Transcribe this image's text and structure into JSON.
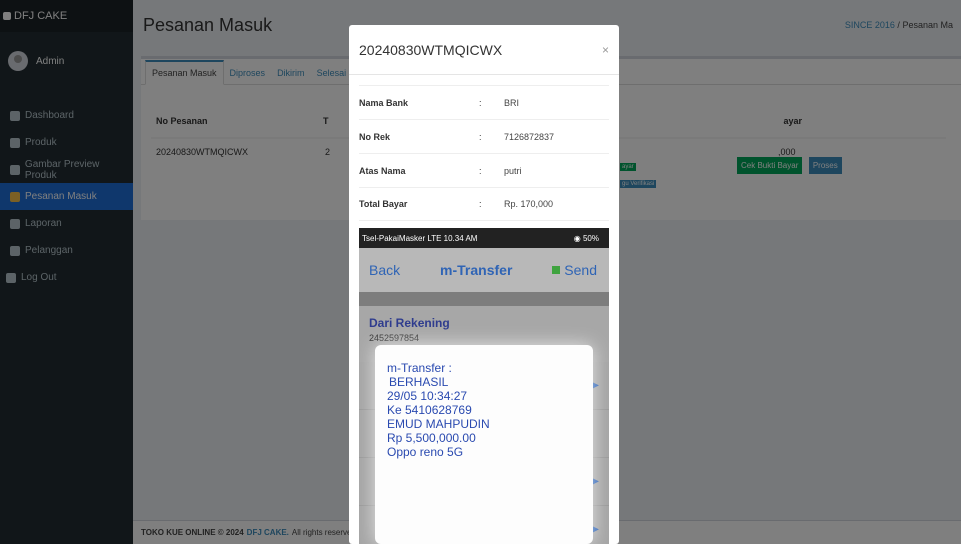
{
  "sidebar": {
    "brand": "DFJ CAKE",
    "user": "Admin",
    "items": [
      {
        "label": "Dashboard",
        "icon": "dashboard-icon"
      },
      {
        "label": "Produk",
        "icon": "building-icon"
      },
      {
        "label": "Gambar Preview Produk",
        "icon": "image-icon"
      },
      {
        "label": "Pesanan Masuk",
        "icon": "download-icon",
        "active": true
      },
      {
        "label": "Laporan",
        "icon": "file-icon"
      },
      {
        "label": "Pelanggan",
        "icon": "users-icon"
      },
      {
        "label": "Log Out",
        "icon": "logout-icon"
      }
    ]
  },
  "header": {
    "title": "Pesanan Masuk",
    "breadcrumb_link": "SINCE 2016",
    "breadcrumb_sep": "/",
    "breadcrumb_current": "Pesanan Ma"
  },
  "tabs": [
    "Pesanan Masuk",
    "Diproses",
    "Dikirim",
    "Selesai"
  ],
  "table": {
    "col_no_pesanan": "No Pesanan",
    "col_total_partial": "T",
    "col_bayar_partial": "ayar",
    "row_no": "20240830WTMQICWX",
    "row_total_partial": "2",
    "row_bayar_partial": ",000",
    "badge1_partial": "ayar",
    "badge2_partial": "gu Verifikasi",
    "btn_cek": "Cek Bukti Bayar",
    "btn_proses": "Proses"
  },
  "footer": {
    "text": "TOKO KUE ONLINE © 2024",
    "brand": "DFJ CAKE.",
    "rest": "All rights reserved."
  },
  "modal": {
    "title": "20240830WTMQICWX",
    "close": "×",
    "rows": [
      {
        "label": "Nama Bank",
        "sep": ":",
        "value": "BRI"
      },
      {
        "label": "No Rek",
        "sep": ":",
        "value": "7126872837"
      },
      {
        "label": "Atas Nama",
        "sep": ":",
        "value": "putri"
      },
      {
        "label": "Total Bayar",
        "sep": ":",
        "value": "Rp. 170,000"
      }
    ]
  },
  "phone": {
    "carrier": "Tsel-PakaiMasker  LTE  10.34 AM",
    "battery": "◉ 50%",
    "nav_back": "Back",
    "nav_title": "m-Transfer",
    "nav_send": "Send",
    "from_label": "Dari Rekening",
    "from_value": "2452597854",
    "popup": [
      "m-Transfer :",
      "BERHASIL",
      "29/05 10:34:27",
      "Ke 5410628769",
      "EMUD MAHPUDIN",
      "Rp 5,500,000.00",
      "Oppo reno 5G"
    ]
  }
}
